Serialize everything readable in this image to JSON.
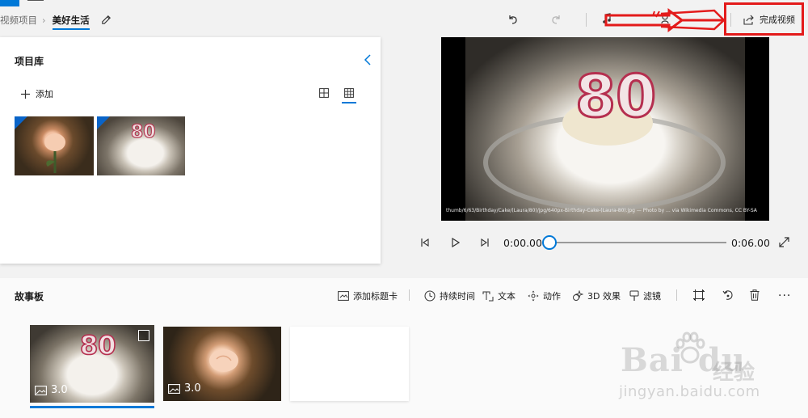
{
  "window": {
    "breadcrumb_root": "视频项目",
    "breadcrumb_current": "美好生活"
  },
  "toolbar": {
    "finish_label": "完成视频",
    "icons": [
      "undo-icon",
      "redo-icon",
      "export-share-icon"
    ]
  },
  "library": {
    "title": "项目库",
    "add_label": "添加",
    "thumbnails": [
      "rose photo",
      "birthday cake photo"
    ]
  },
  "preview": {
    "topper_text": "80",
    "credit_text": "thumb/6/63/Birthday/Cake/(Laura/80)/jpg/640px-Birthday-Cake-(Laura-80).jpg — Photo by ... via Wikimedia Commons, CC BY-SA"
  },
  "player": {
    "current_time": "0:00.00",
    "total_time": "0:06.00",
    "progress": 0
  },
  "storyboard": {
    "title": "故事板",
    "tools": {
      "add_title_card": "添加标题卡",
      "duration": "持续时间",
      "text": "文本",
      "motion": "动作",
      "effects_3d": "3D 效果",
      "filters": "滤镜"
    },
    "cards": [
      {
        "duration": "3.0"
      },
      {
        "duration": "3.0"
      }
    ]
  },
  "watermark": {
    "logo": "Bai",
    "logo_tail": "du",
    "logo_cn": "经验",
    "url": "jingyan.baidu.com"
  },
  "colors": {
    "accent": "#0078d7",
    "highlight_annotation": "#e31b1b"
  }
}
